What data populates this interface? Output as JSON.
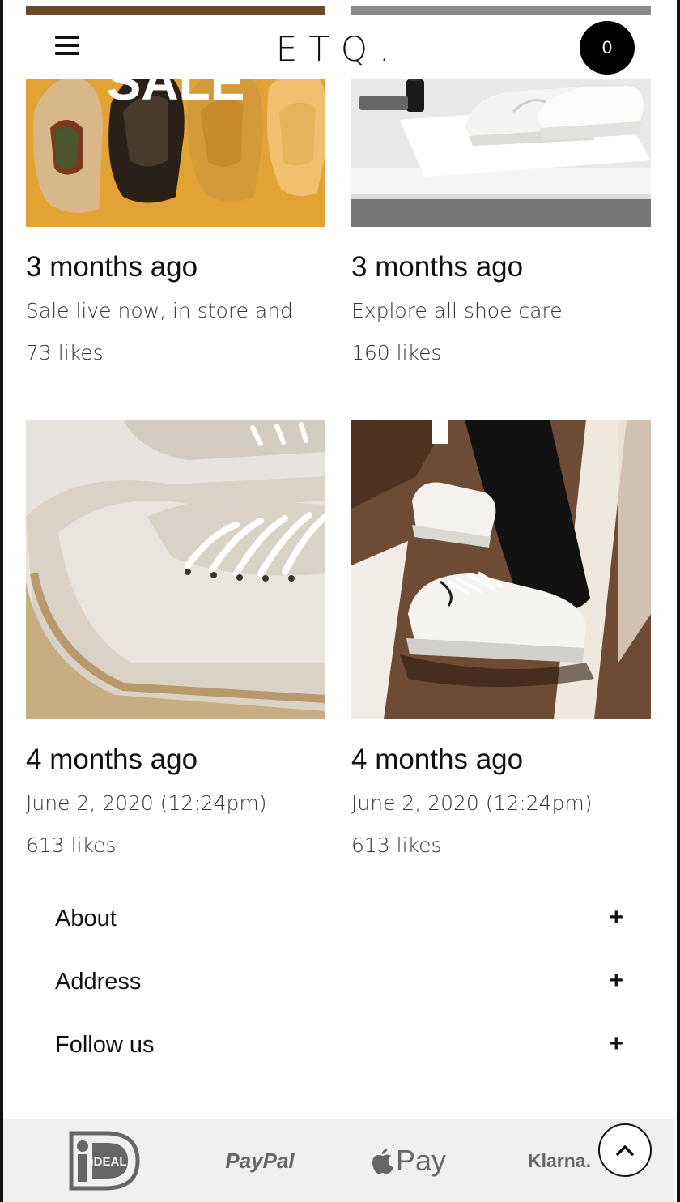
{
  "header": {
    "logo": "ETQ.",
    "cart_count": "0"
  },
  "posts": [
    {
      "time": "3 months ago",
      "caption": "Sale live now, in store and",
      "likes": "73 likes",
      "overlay": "SALE"
    },
    {
      "time": "3 months ago",
      "caption": "Explore all shoe care",
      "likes": "160 likes"
    },
    {
      "time": "4 months ago",
      "caption": "June 2, 2020 (12:24pm)",
      "likes": "613 likes"
    },
    {
      "time": "4 months ago",
      "caption": "June 2, 2020 (12:24pm)",
      "likes": "613 likes"
    }
  ],
  "footer": {
    "sections": [
      {
        "label": "About",
        "icon": "+"
      },
      {
        "label": "Address",
        "icon": "+"
      },
      {
        "label": "Follow us",
        "icon": "+"
      }
    ],
    "payments": [
      "iDEAL",
      "PayPal",
      "Pay",
      "Klarna."
    ]
  },
  "colors": {
    "sale_bg": "#e0a030",
    "payments_bg": "#f0f0f0",
    "cart_bg": "#000000"
  }
}
